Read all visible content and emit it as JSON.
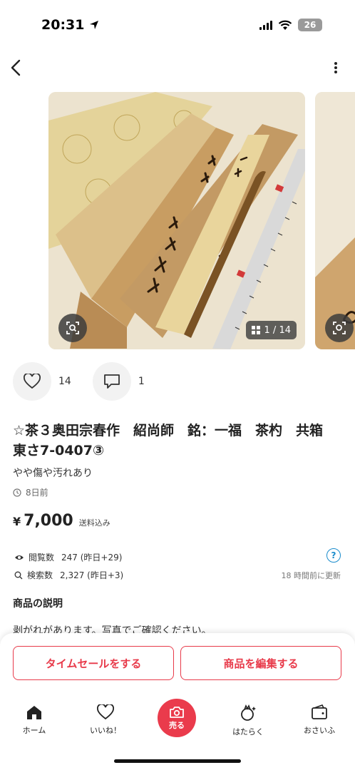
{
  "status_bar": {
    "time": "20:31",
    "battery": "26"
  },
  "item": {
    "title": "☆茶３奥田宗春作　紹尚師　銘：一福　茶杓　共箱　東さ7-0407③",
    "condition": "やや傷や汚れあり",
    "posted": "8日前",
    "price_symbol": "¥",
    "price": "7,000",
    "shipping": "送料込み"
  },
  "gallery": {
    "counter": "1 / 14"
  },
  "actions": {
    "likes": "14",
    "comments": "1"
  },
  "stats": {
    "views_label": "閲覧数",
    "views_value": "247 (昨日+29)",
    "search_label": "検索数",
    "search_value": "2,327 (昨日+3)",
    "help": "?",
    "updated": "18 時間前に更新"
  },
  "description": {
    "heading": "商品の説明",
    "text": "剥がれがあります。写真でご確認ください。"
  },
  "cta": {
    "timesale": "タイムセールをする",
    "edit": "商品を編集する"
  },
  "tabs": [
    {
      "label": "ホーム",
      "icon": "home-icon"
    },
    {
      "label": "いいね！",
      "icon": "heart-icon"
    },
    {
      "label": "売る",
      "icon": "camera-icon"
    },
    {
      "label": "はたらく",
      "icon": "work-icon"
    },
    {
      "label": "おさいふ",
      "icon": "wallet-icon"
    }
  ],
  "colors": {
    "accent": "#e83a4a",
    "help": "#1a8ccc"
  }
}
